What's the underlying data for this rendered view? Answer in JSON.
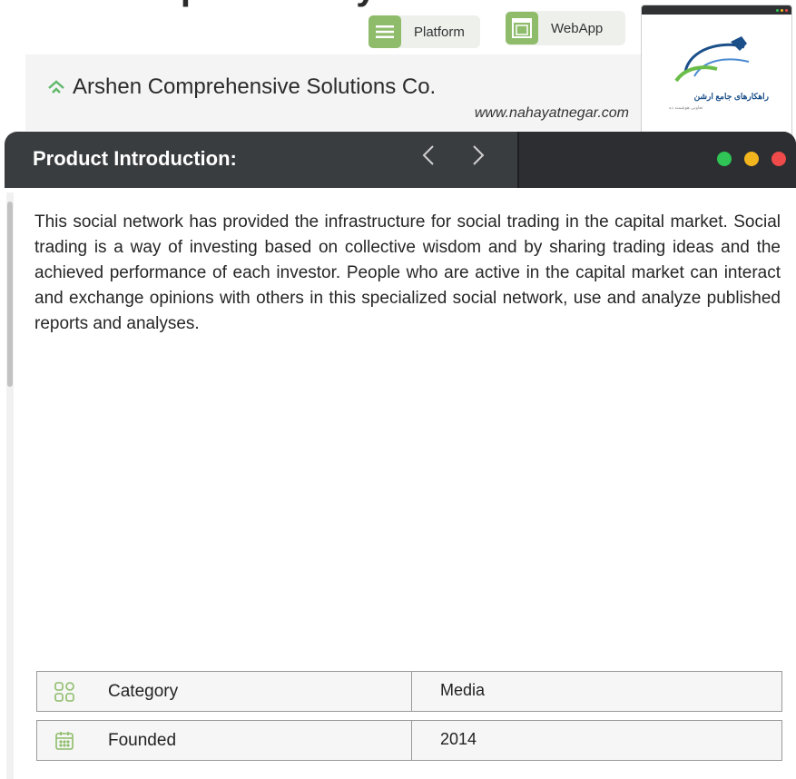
{
  "page": {
    "top_title": "Complete Study"
  },
  "chips": {
    "platform": "Platform",
    "webapp": "WebApp"
  },
  "company": {
    "name": "Arshen Comprehensive Solutions Co.",
    "url": "www.nahayatnegar.com"
  },
  "preview": {
    "logo_text": "راهکارهای جامع ارشن",
    "logo_sub": "تعاونی هوشمند ده"
  },
  "section": {
    "title": "Product Introduction:",
    "prev_label": "‹",
    "next_label": "›"
  },
  "window_dots": {
    "colors": [
      "#2fc455",
      "#f3b51e",
      "#ef4b4b"
    ]
  },
  "description": "This social network has provided the infrastructure for social trading in the capital market. Social trading is a way of investing based on collective wisdom and by sharing trading ideas and the achieved performance of each investor. People who are active in the capital market can interact and exchange opinions with others in this specialized social network, use and analyze published reports and analyses.",
  "info": [
    {
      "label": "Category",
      "value": "Media",
      "icon": "grid-icon"
    },
    {
      "label": "Founded",
      "value": "2014",
      "icon": "calendar-icon"
    }
  ],
  "colors": {
    "accent_green": "#8fbc6b",
    "header_dark": "#3a3d40"
  }
}
